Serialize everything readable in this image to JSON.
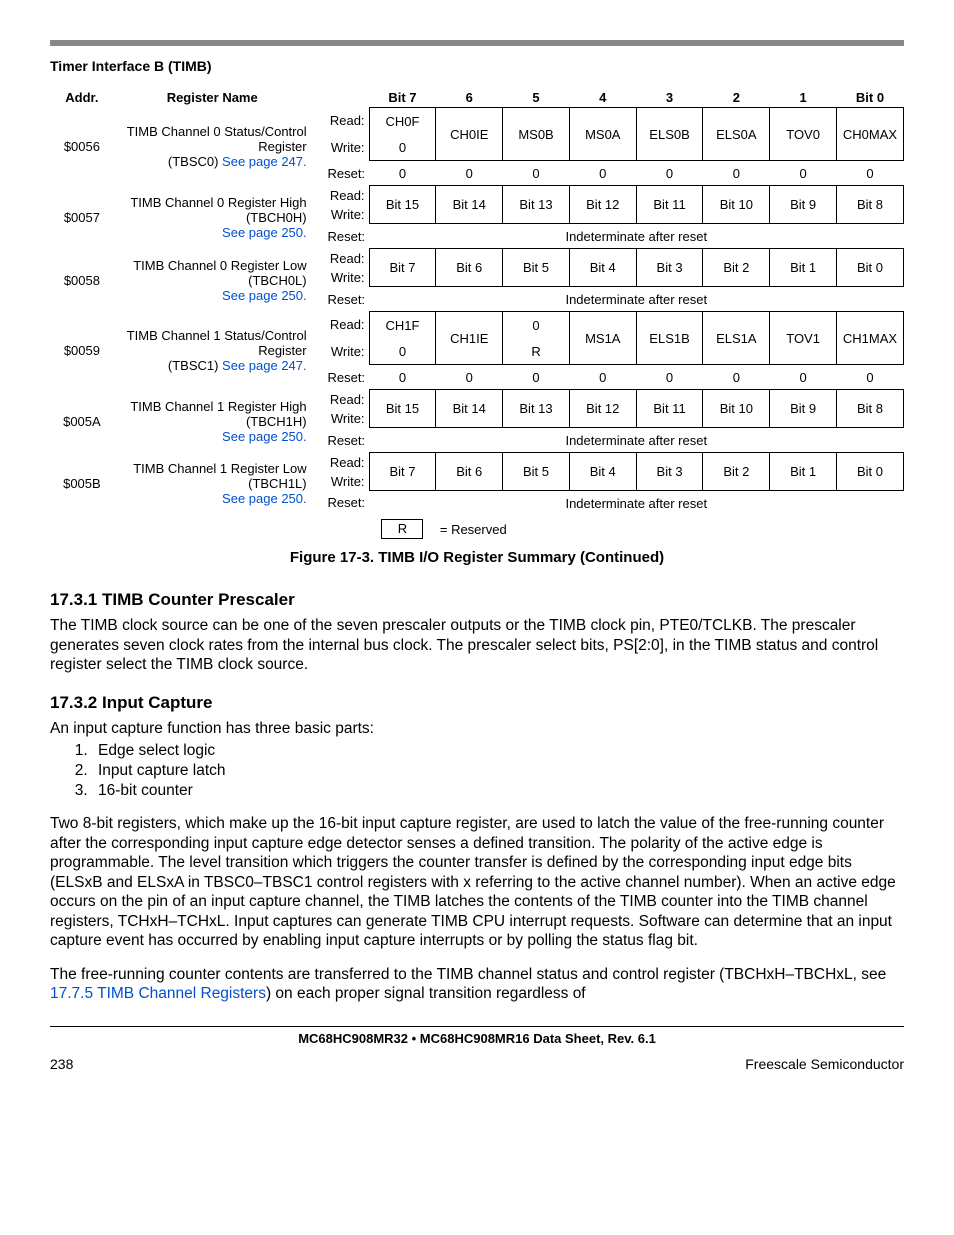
{
  "header": {
    "section": "Timer Interface B (TIMB)"
  },
  "table_headers": {
    "addr": "Addr.",
    "regname": "Register Name",
    "bit7": "Bit 7",
    "b6": "6",
    "b5": "5",
    "b4": "4",
    "b3": "3",
    "b2": "2",
    "b1": "1",
    "bit0": "Bit 0"
  },
  "rw": {
    "read": "Read:",
    "write": "Write:",
    "reset": "Reset:"
  },
  "indet": "Indeterminate after reset",
  "legend": {
    "R": "R",
    "eq": "= Reserved"
  },
  "rows": [
    {
      "addr": "$0056",
      "name_l1": "TIMB Channel 0 Status/Control",
      "name_l2": "Register",
      "name_l3a": "(TBSC0) ",
      "name_l3_link": "See page 247.",
      "read": [
        "CH0F",
        "CH0IE",
        "MS0B",
        "MS0A",
        "ELS0B",
        "ELS0A",
        "TOV0",
        "CH0MAX"
      ],
      "write": [
        "0",
        "",
        "",
        "",
        "",
        "",
        "",
        ""
      ],
      "reset": [
        "0",
        "0",
        "0",
        "0",
        "0",
        "0",
        "0",
        "0"
      ],
      "merge_rw": [
        false,
        true,
        true,
        true,
        true,
        true,
        true,
        true
      ]
    },
    {
      "addr": "$0057",
      "name_l1": "TIMB Channel 0 Register High",
      "name_l2": "(TBCH0H)",
      "name_l3_link": "See page 250.",
      "read": [
        "Bit 15",
        "Bit 14",
        "Bit 13",
        "Bit 12",
        "Bit 11",
        "Bit 10",
        "Bit 9",
        "Bit 8"
      ],
      "merge_rw": [
        true,
        true,
        true,
        true,
        true,
        true,
        true,
        true
      ],
      "reset_indet": true
    },
    {
      "addr": "$0058",
      "name_l1": "TIMB Channel 0 Register Low",
      "name_l2": "(TBCH0L)",
      "name_l3_link": "See page 250.",
      "read": [
        "Bit 7",
        "Bit 6",
        "Bit 5",
        "Bit 4",
        "Bit 3",
        "Bit 2",
        "Bit 1",
        "Bit 0"
      ],
      "merge_rw": [
        true,
        true,
        true,
        true,
        true,
        true,
        true,
        true
      ],
      "reset_indet": true
    },
    {
      "addr": "$0059",
      "name_l1": "TIMB Channel 1 Status/Control",
      "name_l2": "Register",
      "name_l3a": "(TBSC1) ",
      "name_l3_link": "See page 247.",
      "read": [
        "CH1F",
        "CH1IE",
        "0",
        "MS1A",
        "ELS1B",
        "ELS1A",
        "TOV1",
        "CH1MAX"
      ],
      "write": [
        "0",
        "",
        "R",
        "",
        "",
        "",
        "",
        ""
      ],
      "reset": [
        "0",
        "0",
        "0",
        "0",
        "0",
        "0",
        "0",
        "0"
      ],
      "merge_rw": [
        false,
        true,
        false,
        true,
        true,
        true,
        true,
        true
      ]
    },
    {
      "addr": "$005A",
      "name_l1": "TIMB Channel 1 Register High",
      "name_l2": "(TBCH1H)",
      "name_l3_link": "See page 250.",
      "read": [
        "Bit 15",
        "Bit 14",
        "Bit 13",
        "Bit 12",
        "Bit 11",
        "Bit 10",
        "Bit 9",
        "Bit 8"
      ],
      "merge_rw": [
        true,
        true,
        true,
        true,
        true,
        true,
        true,
        true
      ],
      "reset_indet": true
    },
    {
      "addr": "$005B",
      "name_l1": "TIMB Channel 1 Register Low",
      "name_l2": "(TBCH1L)",
      "name_l3_link": "See page 250.",
      "read": [
        "Bit 7",
        "Bit 6",
        "Bit 5",
        "Bit 4",
        "Bit 3",
        "Bit 2",
        "Bit 1",
        "Bit 0"
      ],
      "merge_rw": [
        true,
        true,
        true,
        true,
        true,
        true,
        true,
        true
      ],
      "reset_indet": true
    }
  ],
  "figure_caption": "Figure 17-3. TIMB I/O Register Summary (Continued)",
  "sec1": {
    "title": "17.3.1  TIMB Counter Prescaler",
    "para_a": "The TIMB clock source can be one of the seven prescaler outputs or the TIMB clock pin, ",
    "para_b": "PTE0/TCLKB",
    "para_c": ". The prescaler generates seven clock rates from the internal bus clock. The prescaler select bits, PS[2:0], in the TIMB status and control register select the TIMB clock source."
  },
  "sec2": {
    "title": "17.3.2  Input Capture",
    "intro": "An input capture function has three basic parts:",
    "items": [
      "Edge select logic",
      "Input capture latch",
      "16-bit counter"
    ],
    "para1": "Two 8-bit registers, which make up the 16-bit input capture register, are used to latch the value of the free-running counter after the corresponding input capture edge detector senses a defined transition. The polarity of the active edge is programmable. The level transition which triggers the counter transfer is defined by the corresponding input edge bits (ELSxB and ELSxA in TBSC0–TBSC1 control registers with x referring to the active channel number). When an active edge occurs on the pin of an input capture channel, the TIMB latches the contents of the TIMB counter into the TIMB channel registers, TCHxH–TCHxL. Input captures can generate TIMB CPU interrupt requests. Software can determine that an input capture event has occurred by enabling input capture interrupts or by polling the status flag bit.",
    "para2_a": "The free-running counter contents are transferred to the TIMB channel status and control register (TBCHxH–TBCHxL, see ",
    "para2_link": "17.7.5 TIMB Channel Registers",
    "para2_b": ") on each proper signal transition regardless of"
  },
  "footer": {
    "center": "MC68HC908MR32 • MC68HC908MR16 Data Sheet, Rev. 6.1",
    "left": "238",
    "right": "Freescale Semiconductor"
  }
}
